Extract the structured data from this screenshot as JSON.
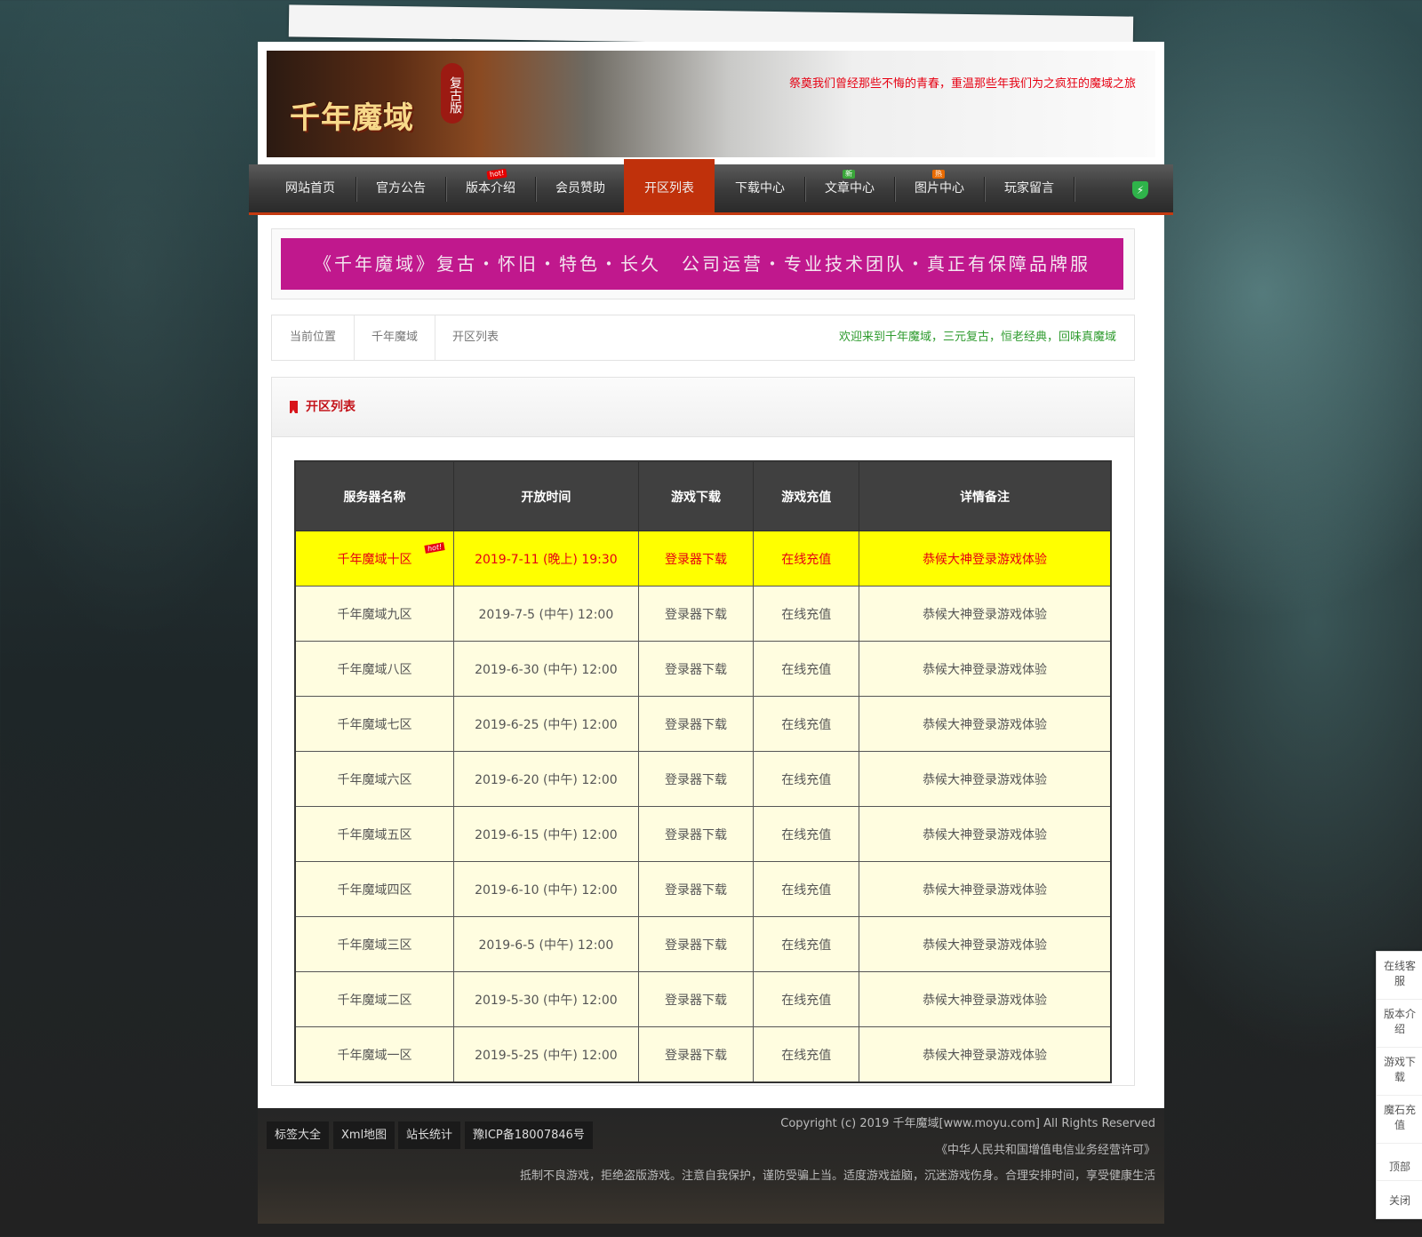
{
  "header": {
    "logo_text": "千年魔域",
    "logo_badge": "复古版",
    "slogan": "祭奠我们曾经那些不悔的青春，重温那些年我们为之疯狂的魔域之旅"
  },
  "nav": {
    "items": [
      {
        "label": "网站首页",
        "badge": ""
      },
      {
        "label": "官方公告",
        "badge": ""
      },
      {
        "label": "版本介绍",
        "badge": "hot!"
      },
      {
        "label": "会员赞助",
        "badge": ""
      },
      {
        "label": "开区列表",
        "badge": ""
      },
      {
        "label": "下载中心",
        "badge": ""
      },
      {
        "label": "文章中心",
        "badge": "新"
      },
      {
        "label": "图片中心",
        "badge": "热"
      },
      {
        "label": "玩家留言",
        "badge": ""
      }
    ],
    "active": "开区列表"
  },
  "ad_banner": "《千年魔域》复古・怀旧・特色・长久　公司运营・专业技术团队・真正有保障品牌服",
  "breadcrumb": {
    "items": [
      "当前位置",
      "千年魔域",
      "开区列表"
    ],
    "welcome": "欢迎来到千年魔域，三元复古，恒老经典，回味真魔域"
  },
  "list": {
    "title": "开区列表",
    "columns": [
      "服务器名称",
      "开放时间",
      "游戏下载",
      "游戏充值",
      "详情备注"
    ],
    "hot_tag": "hot!",
    "rows": [
      {
        "name": "千年魔域十区",
        "time": "2019-7-11 (晚上) 19:30",
        "download": "登录器下载",
        "recharge": "在线充值",
        "note": "恭候大神登录游戏体验"
      },
      {
        "name": "千年魔域九区",
        "time": "2019-7-5 (中午) 12:00",
        "download": "登录器下载",
        "recharge": "在线充值",
        "note": "恭候大神登录游戏体验"
      },
      {
        "name": "千年魔域八区",
        "time": "2019-6-30 (中午) 12:00",
        "download": "登录器下载",
        "recharge": "在线充值",
        "note": "恭候大神登录游戏体验"
      },
      {
        "name": "千年魔域七区",
        "time": "2019-6-25 (中午) 12:00",
        "download": "登录器下载",
        "recharge": "在线充值",
        "note": "恭候大神登录游戏体验"
      },
      {
        "name": "千年魔域六区",
        "time": "2019-6-20 (中午) 12:00",
        "download": "登录器下载",
        "recharge": "在线充值",
        "note": "恭候大神登录游戏体验"
      },
      {
        "name": "千年魔域五区",
        "time": "2019-6-15 (中午) 12:00",
        "download": "登录器下载",
        "recharge": "在线充值",
        "note": "恭候大神登录游戏体验"
      },
      {
        "name": "千年魔域四区",
        "time": "2019-6-10 (中午) 12:00",
        "download": "登录器下载",
        "recharge": "在线充值",
        "note": "恭候大神登录游戏体验"
      },
      {
        "name": "千年魔域三区",
        "time": "2019-6-5 (中午) 12:00",
        "download": "登录器下载",
        "recharge": "在线充值",
        "note": "恭候大神登录游戏体验"
      },
      {
        "name": "千年魔域二区",
        "time": "2019-5-30 (中午) 12:00",
        "download": "登录器下载",
        "recharge": "在线充值",
        "note": "恭候大神登录游戏体验"
      },
      {
        "name": "千年魔域一区",
        "time": "2019-5-25 (中午) 12:00",
        "download": "登录器下载",
        "recharge": "在线充值",
        "note": "恭候大神登录游戏体验"
      }
    ]
  },
  "footer": {
    "links": [
      "标签大全",
      "Xml地图",
      "站长统计",
      "豫ICP备18007846号"
    ],
    "copyright": "Copyright (c) 2019 千年魔域[www.moyu.com] All Rights Reserved",
    "license": "《中华人民共和国增值电信业务经营许可》",
    "notice": "抵制不良游戏，拒绝盗版游戏。注意自我保护，谨防受骗上当。适度游戏益脑，沉迷游戏伤身。合理安排时间，享受健康生活"
  },
  "side_bar": {
    "items": [
      "在线客服",
      "版本介绍",
      "游戏下载",
      "魔石充值",
      "顶部",
      "关闭"
    ]
  },
  "colors": {
    "accent_red": "#e60012",
    "nav_active": "#c0310b",
    "ad_magenta": "#c0188d",
    "welcome_green": "#2e9b2e",
    "highlight_row": "#ffff00"
  },
  "icons": [
    "shield-icon",
    "bookmark-icon"
  ]
}
